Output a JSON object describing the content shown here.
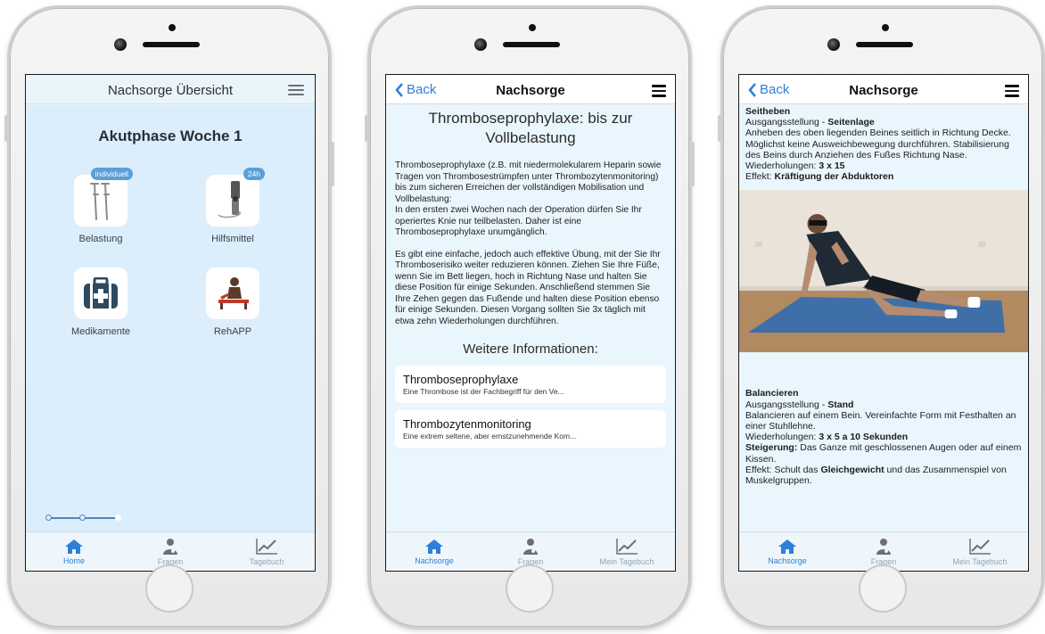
{
  "screen1": {
    "title": "Nachsorge Übersicht",
    "phase": "Akutphase Woche 1",
    "tiles": [
      {
        "label": "Belastung",
        "badge": "individuell",
        "icon": "crutches-icon"
      },
      {
        "label": "Hilfsmittel",
        "badge": "24h",
        "icon": "knee-brace-icon"
      },
      {
        "label": "Medikamente",
        "badge": "",
        "icon": "first-aid-kit-icon"
      },
      {
        "label": "RehAPP",
        "badge": "",
        "icon": "physiotherapy-icon"
      }
    ],
    "tabs": [
      {
        "label": "Home",
        "icon": "home-icon",
        "active": true
      },
      {
        "label": "Fragen",
        "icon": "doctor-icon",
        "active": false
      },
      {
        "label": "Tagebuch",
        "icon": "chart-icon",
        "active": false
      }
    ],
    "progress": {
      "step": 2,
      "total": 12
    }
  },
  "screen2": {
    "back": "Back",
    "title": "Nachsorge",
    "heading": "Thromboseprophylaxe: bis zur Vollbelastung",
    "para1a": "Thromboseprophylaxe (z.B. mit niedermolekularem Heparin sowie Tragen von Thrombosestrümpfen unter Thrombozytenmonitoring) bis zum sicheren Erreichen der vollständigen Mobilisation und Vollbelastung:",
    "para1b": "In den ersten zwei Wochen nach der Operation dürfen Sie Ihr operiertes Knie nur teilbelasten. Daher ist eine Thromboseprophylaxe unumgänglich.",
    "para2": "Es gibt eine einfache, jedoch auch effektive Übung, mit der Sie Ihr Thromboserisiko weiter reduzieren können. Ziehen Sie Ihre Füße, wenn Sie im Bett liegen, hoch in Richtung Nase und halten Sie diese Position für einige Sekunden. Anschließend stemmen Sie Ihre Zehen gegen das Fußende und halten diese Position ebenso für einige Sekunden. Diesen Vorgang sollten Sie 3x täglich mit etwa zehn Wiederholungen durchführen.",
    "more_heading": "Weitere Informationen:",
    "cards": [
      {
        "title": "Thromboseprophylaxe",
        "sub": "Eine Thrombose ist der Fachbegriff für den Ve..."
      },
      {
        "title": "Thrombozytenmonitoring",
        "sub": "Eine extrem seltene, aber ernstzunehmende Kom..."
      }
    ],
    "tabs": [
      {
        "label": "Nachsorge",
        "icon": "home-icon",
        "active": true
      },
      {
        "label": "Fragen",
        "icon": "doctor-icon",
        "active": false
      },
      {
        "label": "Mein Tagebuch",
        "icon": "chart-icon",
        "active": false
      }
    ]
  },
  "screen3": {
    "back": "Back",
    "title": "Nachsorge",
    "ex1": {
      "name": "Seitheben",
      "start_label": "Ausgangsstellung - ",
      "start_value": "Seitenlage",
      "description": "Anheben des oben liegenden Beines seitlich in Richtung Decke. Möglichst keine Ausweichbewegung durchführen. Stabilisierung des Beins durch Anziehen des Fußes Richtung Nase.",
      "reps_label": "Wiederholungen: ",
      "reps_value": "3 x 15",
      "effect_label": "Effekt: ",
      "effect_value": "Kräftigung der Abduktoren"
    },
    "ex2": {
      "name": "Balancieren",
      "start_label": "Ausgangsstellung - ",
      "start_value": "Stand",
      "description": "Balancieren auf einem Bein. Vereinfachte Form mit Festhalten an einer Stuhllehne.",
      "reps_label": "Wiederholungen: ",
      "reps_value": "3 x 5 a 10 Sekunden",
      "incr_label": "Steigerung:",
      "incr_value": " Das Ganze mit geschlossenen Augen oder auf einem Kissen.",
      "effect_label": "Effekt: Schult das ",
      "effect_value": "Gleichgewicht",
      "effect_rest": " und das Zusammenspiel von Muskelgruppen."
    },
    "tabs": [
      {
        "label": "Nachsorge",
        "icon": "home-icon",
        "active": true
      },
      {
        "label": "Fragen",
        "icon": "doctor-icon",
        "active": false
      },
      {
        "label": "Mein Tagebuch",
        "icon": "chart-icon",
        "active": false
      }
    ]
  },
  "colors": {
    "accent": "#2f7fd6",
    "badge": "#5a9fd8",
    "screen_bg": "#dceefb"
  }
}
